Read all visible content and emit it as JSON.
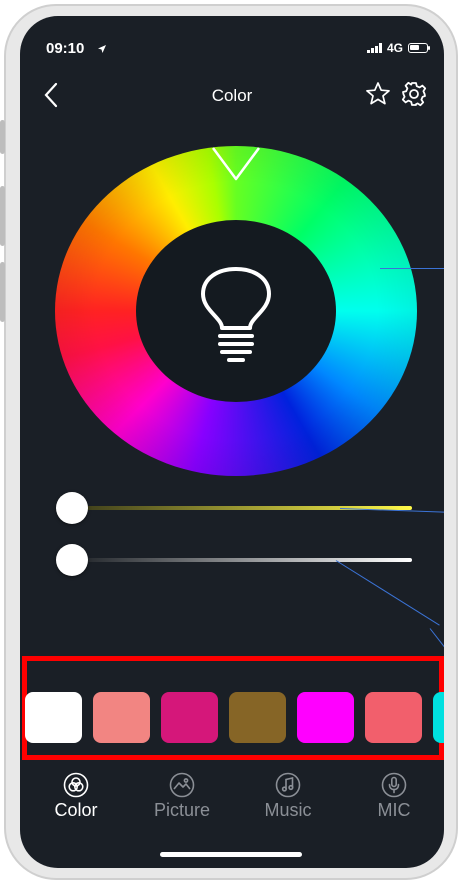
{
  "status_bar": {
    "time": "09:10",
    "network": "4G"
  },
  "header": {
    "title": "Color"
  },
  "presets": [
    {
      "color": "#ffffff"
    },
    {
      "color": "#f28582"
    },
    {
      "color": "#d5177a"
    },
    {
      "color": "#866526"
    },
    {
      "color": "#ff00ff"
    },
    {
      "color": "#f25f6c"
    },
    {
      "color": "#00e0e0"
    }
  ],
  "tabs": [
    {
      "label": "Color",
      "icon": "rgb-circles-icon",
      "active": true
    },
    {
      "label": "Picture",
      "icon": "image-icon",
      "active": false
    },
    {
      "label": "Music",
      "icon": "music-note-icon",
      "active": false
    },
    {
      "label": "MIC",
      "icon": "microphone-icon",
      "active": false
    }
  ],
  "colors": {
    "background": "#1a1f26",
    "accent_highlight": "#ff0000",
    "callout": "#3b73d6"
  }
}
